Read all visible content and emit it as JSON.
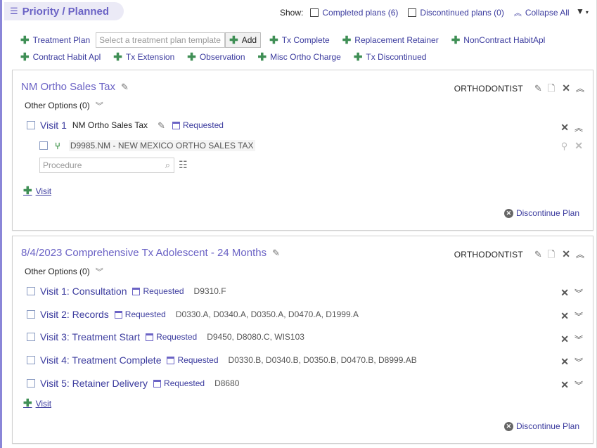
{
  "header": {
    "title": "Priority / Planned",
    "show_label": "Show:",
    "completed_plans": "Completed plans (6)",
    "discontinued_plans": "Discontinued plans (0)",
    "collapse_all": "Collapse All"
  },
  "actions": {
    "row1": [
      "Treatment Plan",
      "Tx Complete",
      "Replacement Retainer",
      "NonContract HabitApl"
    ],
    "template_placeholder": "Select a treatment plan template",
    "add_button": "Add",
    "row2": [
      "Contract Habit Apl",
      "Tx Extension",
      "Observation",
      "Misc Ortho Charge",
      "Tx Discontinued"
    ]
  },
  "plan1": {
    "title": "NM Ortho Sales Tax",
    "provider": "ORTHODONTIST",
    "other_options": "Other Options (0)",
    "visit": {
      "label": "Visit 1",
      "name": "NM Ortho Sales Tax",
      "status": "Requested"
    },
    "procedure": "D9985.NM - NEW MEXICO ORTHO SALES TAX",
    "procedure_placeholder": "Procedure",
    "add_visit": "Visit",
    "discontinue": "Discontinue Plan"
  },
  "plan2": {
    "title": "8/4/2023 Comprehensive Tx Adolescent - 24 Months",
    "provider": "ORTHODONTIST",
    "other_options": "Other Options (0)",
    "visits": [
      {
        "name": "Visit 1: Consultation",
        "status": "Requested",
        "codes": "D9310.F"
      },
      {
        "name": "Visit 2: Records",
        "status": "Requested",
        "codes": "D0330.A, D0340.A, D0350.A, D0470.A, D1999.A"
      },
      {
        "name": "Visit 3: Treatment Start",
        "status": "Requested",
        "codes": "D9450, D8080.C, WIS103"
      },
      {
        "name": "Visit 4: Treatment Complete",
        "status": "Requested",
        "codes": "D0330.B, D0340.B, D0350.B, D0470.B, D8999.AB"
      },
      {
        "name": "Visit 5: Retainer Delivery",
        "status": "Requested",
        "codes": "D8680"
      }
    ],
    "add_visit": "Visit",
    "discontinue": "Discontinue Plan"
  }
}
